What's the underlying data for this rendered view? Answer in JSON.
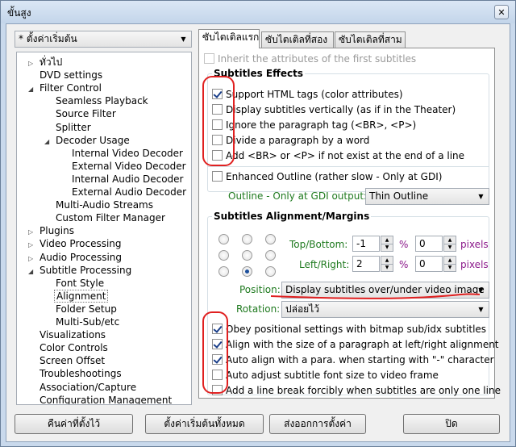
{
  "window": {
    "title": "ขั้นสูง",
    "close_glyph": "✕"
  },
  "profile_combo": {
    "value": "* ตั้งค่าเริ่มต้น"
  },
  "tree": [
    {
      "label": "ทั่วไป",
      "level": 0,
      "expander": "▷"
    },
    {
      "label": "DVD settings",
      "level": 0,
      "expander": ""
    },
    {
      "label": "Filter Control",
      "level": 0,
      "expander": "◢"
    },
    {
      "label": "Seamless Playback",
      "level": 1,
      "expander": ""
    },
    {
      "label": "Source Filter",
      "level": 1,
      "expander": ""
    },
    {
      "label": "Splitter",
      "level": 1,
      "expander": ""
    },
    {
      "label": "Decoder Usage",
      "level": 1,
      "expander": "◢"
    },
    {
      "label": "Internal Video Decoder",
      "level": 2,
      "expander": ""
    },
    {
      "label": "External Video Decoder",
      "level": 2,
      "expander": ""
    },
    {
      "label": "Internal Audio Decoder",
      "level": 2,
      "expander": ""
    },
    {
      "label": "External Audio Decoder",
      "level": 2,
      "expander": ""
    },
    {
      "label": "Multi-Audio Streams",
      "level": 1,
      "expander": ""
    },
    {
      "label": "Custom Filter Manager",
      "level": 1,
      "expander": ""
    },
    {
      "label": "Plugins",
      "level": 0,
      "expander": "▷"
    },
    {
      "label": "Video Processing",
      "level": 0,
      "expander": "▷"
    },
    {
      "label": "Audio Processing",
      "level": 0,
      "expander": "▷"
    },
    {
      "label": "Subtitle Processing",
      "level": 0,
      "expander": "◢"
    },
    {
      "label": "Font Style",
      "level": 1,
      "expander": ""
    },
    {
      "label": "Alignment",
      "level": 1,
      "expander": "",
      "selected": true
    },
    {
      "label": "Folder Setup",
      "level": 1,
      "expander": ""
    },
    {
      "label": "Multi-Sub/etc",
      "level": 1,
      "expander": ""
    },
    {
      "label": "Visualizations",
      "level": 0,
      "expander": ""
    },
    {
      "label": "Color Controls",
      "level": 0,
      "expander": ""
    },
    {
      "label": "Screen Offset",
      "level": 0,
      "expander": ""
    },
    {
      "label": "Troubleshootings",
      "level": 0,
      "expander": ""
    },
    {
      "label": "Association/Capture",
      "level": 0,
      "expander": ""
    },
    {
      "label": "Configuration Management",
      "level": 0,
      "expander": ""
    }
  ],
  "tabs": [
    "ซับไตเติลแรก",
    "ซับไตเติลที่สอง",
    "ซับไตเติลที่สาม"
  ],
  "inherit": {
    "label": "Inherit the attributes of the first subtitles",
    "checked": false
  },
  "effects": {
    "title": "Subtitles Effects",
    "options": [
      {
        "label": "Support HTML tags (color attributes)",
        "checked": true
      },
      {
        "label": "Display subtitles vertically (as if in the Theater)",
        "checked": false
      },
      {
        "label": "Ignore the paragraph tag (<BR>, <P>)",
        "checked": false
      },
      {
        "label": "Divide a paragraph by a word",
        "checked": false
      },
      {
        "label": "Add <BR> or <P> if not exist at the end of a line",
        "checked": false
      }
    ],
    "enhanced": {
      "label": "Enhanced Outline (rather slow - Only at GDI)",
      "checked": false
    },
    "outline_label": "Outline - Only at GDI output:",
    "outline_value": "Thin Outline"
  },
  "alignment": {
    "title": "Subtitles Alignment/Margins",
    "selected_radio": 7,
    "top_bottom": {
      "label": "Top/Bottom:",
      "value1": "-1",
      "unit1": "%",
      "value2": "0",
      "unit2": "pixels"
    },
    "left_right": {
      "label": "Left/Right:",
      "value1": "2",
      "unit1": "%",
      "value2": "0",
      "unit2": "pixels"
    },
    "position_label": "Position:",
    "position_value": "Display subtitles over/under video image",
    "rotation_label": "Rotation:",
    "rotation_value": "ปล่อยไว้",
    "options": [
      {
        "label": "Obey positional settings with bitmap sub/idx subtitles",
        "checked": true
      },
      {
        "label": "Align with the size of a paragraph at left/right alignment",
        "checked": true
      },
      {
        "label": "Auto align with a para. when starting with \"-\" character",
        "checked": true
      },
      {
        "label": "Auto adjust subtitle font size to video frame",
        "checked": false
      },
      {
        "label": "Add a line break forcibly when subtitles are only one line",
        "checked": false
      }
    ]
  },
  "buttons": {
    "restore": "คืนค่าที่ตั้งไว้",
    "reset_all": "ตั้งค่าเริ่มต้นทั้งหมด",
    "export": "ส่งออกการตั้งค่า",
    "close": "ปิด"
  },
  "colors": {
    "annotation": "#e02020",
    "green_label": "#1f7a1f",
    "unit_label": "#8b1a8b"
  }
}
